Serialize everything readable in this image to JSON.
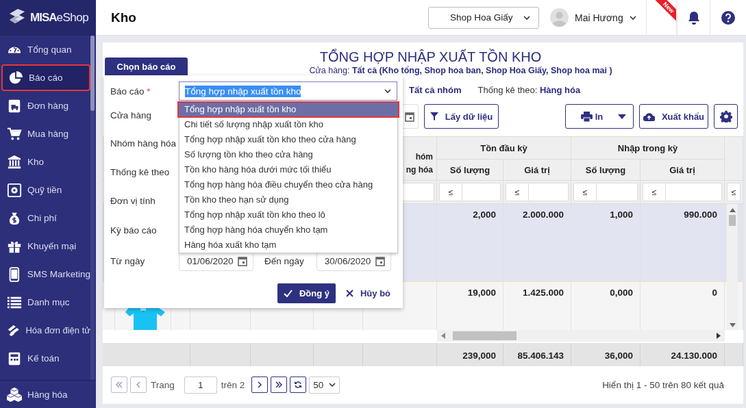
{
  "app": {
    "logo_bold": "MISA",
    "logo_light": "eShop"
  },
  "sidebar": {
    "items": [
      {
        "label": "Tổng quan",
        "selected": false
      },
      {
        "label": "Báo cáo",
        "selected": true
      },
      {
        "label": "Đơn hàng",
        "selected": false
      },
      {
        "label": "Mua hàng",
        "selected": false
      },
      {
        "label": "Kho",
        "selected": false
      },
      {
        "label": "Quỹ tiền",
        "selected": false
      },
      {
        "label": "Chi phí",
        "selected": false
      },
      {
        "label": "Khuyến mại",
        "selected": false
      },
      {
        "label": "SMS Marketing",
        "selected": false
      },
      {
        "label": "Danh mục",
        "selected": false
      },
      {
        "label": "Hóa đơn điện tử",
        "selected": false
      },
      {
        "label": "Kế toán",
        "selected": false
      }
    ],
    "pinned": {
      "label": "Hàng hóa"
    }
  },
  "header": {
    "title": "Kho",
    "shop": "Shop Hoa Giấy",
    "user": "Mai Hương",
    "new_badge": "New"
  },
  "report": {
    "title": "TỔNG HỢP NHẬP XUẤT TỒN KHO",
    "stores_label": "Cửa hàng:",
    "stores_value": "Tất cả (Kho tổng, Shop hoa ban, Shop Hoa Giấy, Shop hoa mai )",
    "group_value": "Tất cả nhóm",
    "stat_label": "Thống kê theo:",
    "stat_value": "Hàng hóa"
  },
  "toolbar": {
    "fetch": "Lấy dữ liệu",
    "print": "In",
    "export": "Xuất khẩu"
  },
  "table": {
    "header_fragment": [
      "hóm",
      "ng hóa"
    ],
    "groups": [
      "Tồn đầu kỳ",
      "Nhập trong kỳ"
    ],
    "subcolumns": [
      "Số lượng",
      "Giá trị",
      "Số lượng",
      "Giá trị"
    ],
    "filter_ops": [
      "≤",
      "≤",
      "≤",
      "≤",
      "≤"
    ],
    "rows": [
      {
        "selected": true,
        "values": [
          "2,000",
          "2.000.000",
          "1,000",
          "990.000"
        ]
      },
      {
        "selected": false,
        "picture": true,
        "values": [
          "19,000",
          "1.425.000",
          "0,000",
          "0"
        ]
      }
    ],
    "totals": [
      "239,000",
      "85.406.143",
      "36,000",
      "24.130.000"
    ]
  },
  "pagination": {
    "page_label": "Trang",
    "page": "1",
    "of": "trên 2",
    "page_size": "50",
    "summary": "Hiển thị 1 - 50 trên 80 kết quả"
  },
  "dialog": {
    "tab": "Chọn báo cáo",
    "fields": [
      {
        "label": "Báo cáo",
        "required": true
      },
      {
        "label": "Cửa hàng",
        "required": false
      },
      {
        "label": "Nhóm hàng hóa",
        "required": false
      },
      {
        "label": "Thống kê theo",
        "required": false
      },
      {
        "label": "Đơn vị tính",
        "required": false
      },
      {
        "label": "Kỳ báo cáo",
        "required": false
      }
    ],
    "required_mark": "*",
    "report_value": "Tổng hợp nhập xuất tồn kho",
    "options": [
      {
        "label": "Tổng hợp nhập xuất tồn kho",
        "selected": true
      },
      {
        "label": "Chi tiết số lượng nhập xuất tồn kho",
        "selected": false
      },
      {
        "label": "Tổng hợp nhập xuất tồn kho theo cửa hàng",
        "selected": false
      },
      {
        "label": "Số lượng tồn kho theo cửa hàng",
        "selected": false
      },
      {
        "label": "Tồn kho hàng hóa dưới mức tối thiểu",
        "selected": false
      },
      {
        "label": "Tổng hợp hàng hóa điều chuyển theo cửa hàng",
        "selected": false
      },
      {
        "label": "Tồn kho theo hạn sử dụng",
        "selected": false
      },
      {
        "label": "Tổng hợp nhập xuất tồn kho theo lô",
        "selected": false
      },
      {
        "label": "Tổng hợp hàng hóa chuyển kho tạm",
        "selected": false
      },
      {
        "label": "Hàng hóa xuất kho tạm",
        "selected": false
      }
    ],
    "from_label": "Từ ngày",
    "from": "01/06/2020",
    "to_label": "Đến ngày",
    "to": "30/06/2020",
    "ok": "Đồng ý",
    "cancel": "Hủy bỏ"
  }
}
